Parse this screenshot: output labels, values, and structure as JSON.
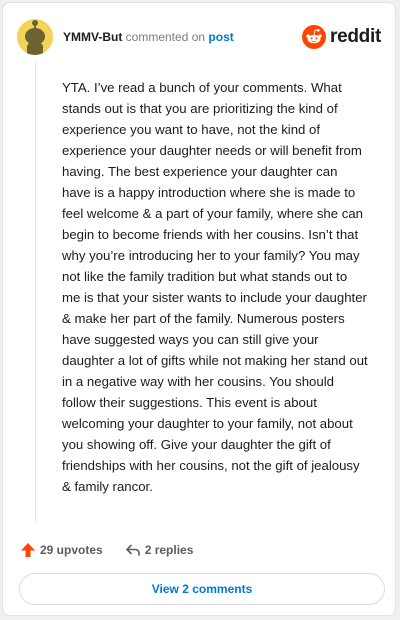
{
  "header": {
    "username": "YMMV-But",
    "action_text": "commented on",
    "post_link": "post",
    "brand": "reddit"
  },
  "comment": {
    "text": "YTA. I’ve read a bunch of your comments. What stands out is that you are prioritizing the kind of experience you want to have, not the kind of experience your daughter needs or will benefit from having. The best experience your daughter can have is a happy introduction where she is made to feel welcome & a part of your family, where she can begin to become friends with her cousins. Isn’t that why you’re introducing her to your family? You may not like the family tradition but what stands out to me is that your sister wants to include your daughter & make her part of the family. Numerous posters have suggested ways you can still give your daughter a lot of gifts while not making her stand out in a negative way with her cousins. You should follow their suggestions. This event is about welcoming your daughter to your family, not about you showing off. Give your daughter the gift of friendships with her cousins, not the gift of jealousy & family rancor."
  },
  "actions": {
    "upvotes": "29 upvotes",
    "replies": "2 replies",
    "view_comments": "View 2 comments"
  },
  "colors": {
    "brand_orange": "#ff4500",
    "link_blue": "#0079d3",
    "avatar_yellow": "#f5d25a"
  },
  "icons": {
    "avatar": "snoo-avatar",
    "upvote": "upvote-arrow-icon",
    "reply": "reply-arrow-icon",
    "brand": "reddit-logo-icon"
  }
}
